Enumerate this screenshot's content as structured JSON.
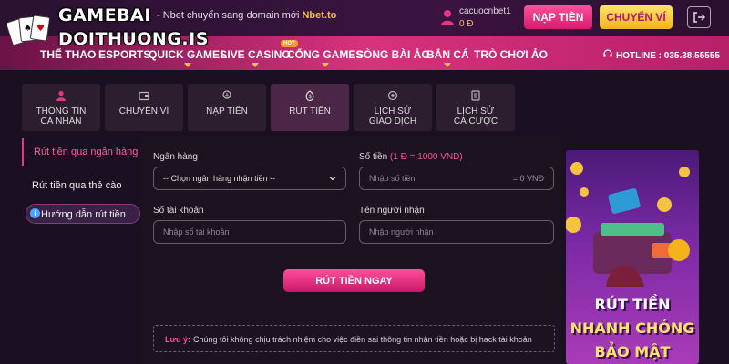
{
  "brand": {
    "logo_line1": "GAMEBAI",
    "logo_line2": "DOITHUONG.IS"
  },
  "header": {
    "domain_note_prefix": "- Nbet chuyển sang domain mới",
    "domain_note_highlight": "Nbet.to",
    "username": "cacuocnbet1",
    "balance": "0 Đ",
    "deposit_label": "NẠP TIỀN",
    "transfer_label": "CHUYỂN VÍ",
    "accent_color": "#e63684",
    "gold_color": "#f5c242"
  },
  "nav": {
    "items": [
      {
        "label": "THỂ THAO"
      },
      {
        "label": "ESPORTS"
      },
      {
        "label": "QUICK GAMES"
      },
      {
        "label": "LIVE CASINO",
        "badge": "HOT"
      },
      {
        "label": "CỔNG GAMES"
      },
      {
        "label": "SÒNG BÀI ẢO"
      },
      {
        "label": "BẮN CÁ"
      },
      {
        "label": "TRÒ CHƠI ẢO"
      }
    ],
    "hotline": "HOTLINE : 035.38.55555"
  },
  "tabs": [
    {
      "line1": "THÔNG TIN",
      "line2": "CÁ NHÂN",
      "icon": "user-icon"
    },
    {
      "line1": "CHUYỂN VÍ",
      "line2": "",
      "icon": "wallet-icon"
    },
    {
      "line1": "NẠP TIỀN",
      "line2": "",
      "icon": "deposit-icon"
    },
    {
      "line1": "RÚT TIỀN",
      "line2": "",
      "icon": "withdraw-icon",
      "active": true
    },
    {
      "line1": "LỊCH SỬ",
      "line2": "GIAO DỊCH",
      "icon": "history-icon"
    },
    {
      "line1": "LỊCH SỬ",
      "line2": "CÁ CƯỢC",
      "icon": "bet-history-icon"
    }
  ],
  "side_menu": {
    "items": [
      {
        "label": "Rút tiền qua ngân hàng",
        "active": true
      },
      {
        "label": "Rút tiền qua thẻ cào"
      },
      {
        "label": "Hướng dẫn rút tiền"
      }
    ]
  },
  "form": {
    "bank_label": "Ngân hàng",
    "bank_select_value": "-- Chọn ngân hàng nhận tiền --",
    "amount_label": "Số tiền",
    "amount_note": "(1 Đ = 1000 VND)",
    "amount_placeholder": "Nhập số tiền",
    "amount_suffix": "= 0 VNĐ",
    "account_label": "Số tài khoản",
    "account_placeholder": "Nhập số tài khoản",
    "recipient_label": "Tên người nhận",
    "recipient_placeholder": "Nhập người nhận",
    "submit_label": "RÚT TIỀN NGAY"
  },
  "notice": {
    "label": "Lưu ý:",
    "text": "Chúng tôi không chịu trách nhiệm cho việc điền sai thông tin nhận tiền hoặc bị hack tài khoản"
  },
  "banner": {
    "line1": "RÚT TIỀN",
    "line2": "NHANH CHÓNG",
    "line3": "BẢO MẬT"
  }
}
